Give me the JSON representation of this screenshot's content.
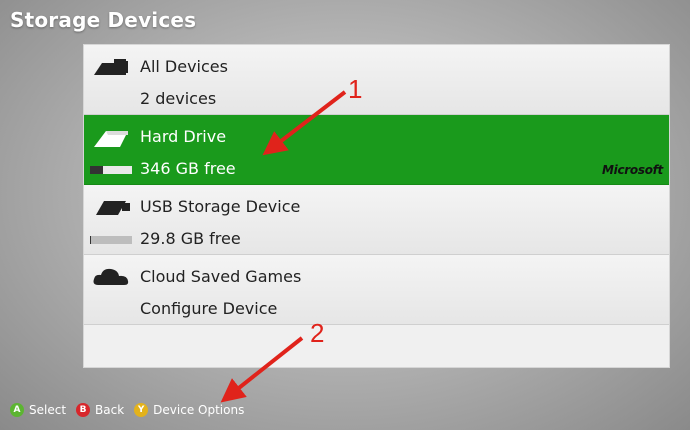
{
  "page": {
    "title": "Storage Devices"
  },
  "devices": [
    {
      "icon": "all-devices-icon",
      "name": "All Devices",
      "detail": "2 devices",
      "selected": false
    },
    {
      "icon": "hard-drive-icon",
      "name": "Hard Drive",
      "detail": "346 GB free",
      "used_fraction": 0.3,
      "brand": "Microsoft",
      "selected": true
    },
    {
      "icon": "usb-drive-icon",
      "name": "USB Storage Device",
      "detail": "29.8 GB free",
      "used_fraction": 0.02,
      "selected": false
    },
    {
      "icon": "cloud-icon",
      "name": "Cloud Saved Games",
      "detail": "Configure Device",
      "selected": false
    }
  ],
  "footer": {
    "hints": [
      {
        "button": "A",
        "label": "Select",
        "color": "#5cb531"
      },
      {
        "button": "B",
        "label": "Back",
        "color": "#d8262b"
      },
      {
        "button": "Y",
        "label": "Device Options",
        "color": "#e3b21b"
      }
    ]
  },
  "annotations": {
    "marker_1": "1",
    "marker_2": "2",
    "color": "#e0231b"
  },
  "colors": {
    "selected_row": "#1a9a1c"
  }
}
